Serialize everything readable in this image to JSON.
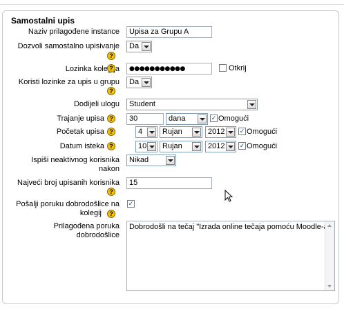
{
  "form": {
    "legend": "Samostalni upis",
    "instance_name": {
      "label": "Naziv prilagođene instance",
      "value": "Upisa za Grupu A"
    },
    "allow_self_enrol": {
      "label_line1": "Dozvoli samostalno upisivanje",
      "value": "Da"
    },
    "enrol_key": {
      "label": "Lozinka kolegija",
      "value": "●●●●●●●●●●●",
      "reveal_label": "Otkrij"
    },
    "group_keys": {
      "label": "Koristi lozinke za upis u grupu",
      "value": "Da"
    },
    "assign_role": {
      "label": "Dodijeli ulogu",
      "value": "Student"
    },
    "enrol_period": {
      "label": "Trajanje upisa",
      "value": "30",
      "unit": "dana",
      "enable_label": "Omogući",
      "enabled": true
    },
    "start_date": {
      "label": "Početak upisa",
      "day": "4",
      "month": "Rujan",
      "year": "2012",
      "enable_label": "Omogući",
      "enabled": true
    },
    "end_date": {
      "label": "Datum isteka",
      "day": "10",
      "month": "Rujan",
      "year": "2012",
      "enable_label": "Omogući",
      "enabled": true
    },
    "unenrol_inactive": {
      "label_line1": "Ispiši neaktivnog korisnika",
      "label_line2": "nakon",
      "value": "Nikad"
    },
    "max_enrolled": {
      "label": "Najveći broj upisanih korisnika",
      "value": "15"
    },
    "send_welcome": {
      "label_line1": "Pošalji poruku dobrodošlice na",
      "label_line2": "kolegij",
      "checked": true
    },
    "custom_welcome": {
      "label_line1": "Prilagođena poruka",
      "label_line2": "dobrodošlice",
      "value": "Dobrodošli na tečaj \"Izrada online tečaja pomoću Moodle-a\""
    },
    "help_glyph": "?",
    "check_glyph": "✓",
    "icons": {
      "help": "help-icon",
      "dropdown": "chevron-down-icon"
    }
  }
}
